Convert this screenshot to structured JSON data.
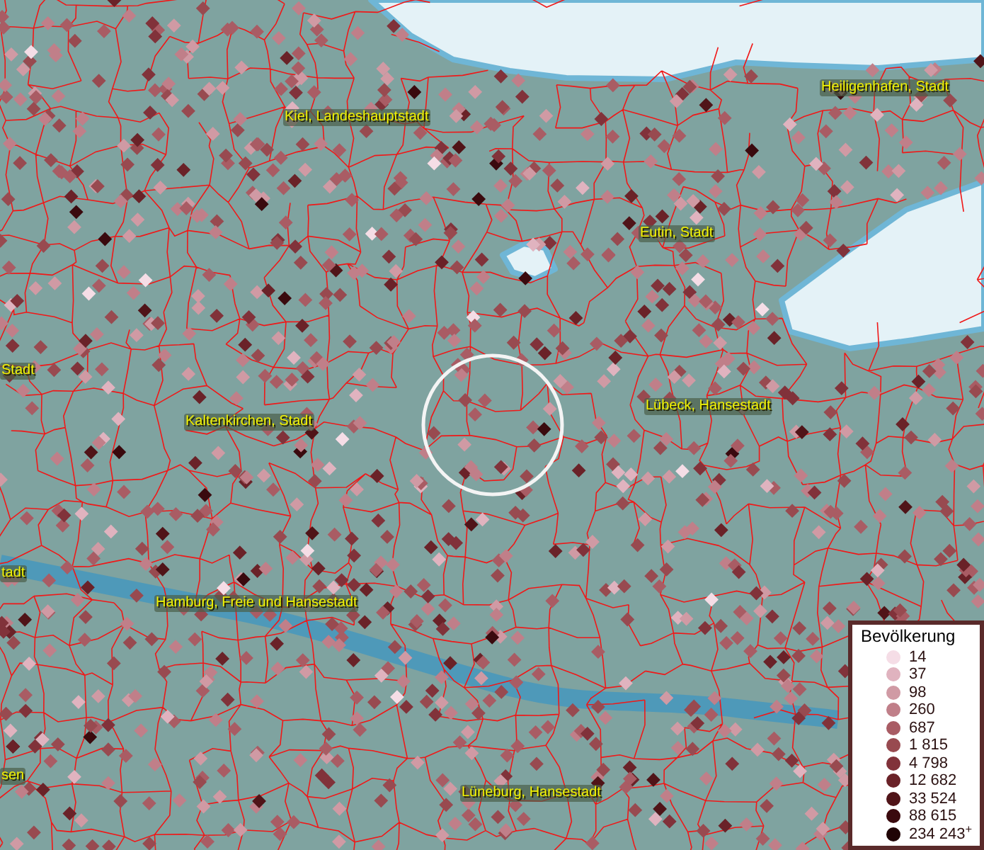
{
  "map_labels": [
    {
      "text": "Heiligenhafen, Stadt"
    },
    {
      "text": "Kiel, Landeshauptstadt"
    },
    {
      "text": "Eutin, Stadt"
    },
    {
      "text": "Stadt"
    },
    {
      "text": "Lübeck, Hansestadt"
    },
    {
      "text": "Kaltenkirchen, Stadt"
    },
    {
      "text": "tadt"
    },
    {
      "text": "Hamburg, Freie und Hansestadt"
    },
    {
      "text": "sen"
    },
    {
      "text": "Lüneburg, Hansestadt"
    }
  ],
  "legend": {
    "title": "Bevölkerung",
    "items": [
      {
        "label": "14",
        "color": "#f5dde6"
      },
      {
        "label": "37",
        "color": "#e0b3bf"
      },
      {
        "label": "98",
        "color": "#d09aa4"
      },
      {
        "label": "260",
        "color": "#c07f89"
      },
      {
        "label": "687",
        "color": "#a95c64"
      },
      {
        "label": "1 815",
        "color": "#984a50"
      },
      {
        "label": "4 798",
        "color": "#81323a"
      },
      {
        "label": "12 682",
        "color": "#6a2228"
      },
      {
        "label": "33 524",
        "color": "#501418"
      },
      {
        "label": "88 615",
        "color": "#3a0a0e"
      },
      {
        "label": "234 243$^{+}$",
        "color": "#200406"
      }
    ]
  }
}
